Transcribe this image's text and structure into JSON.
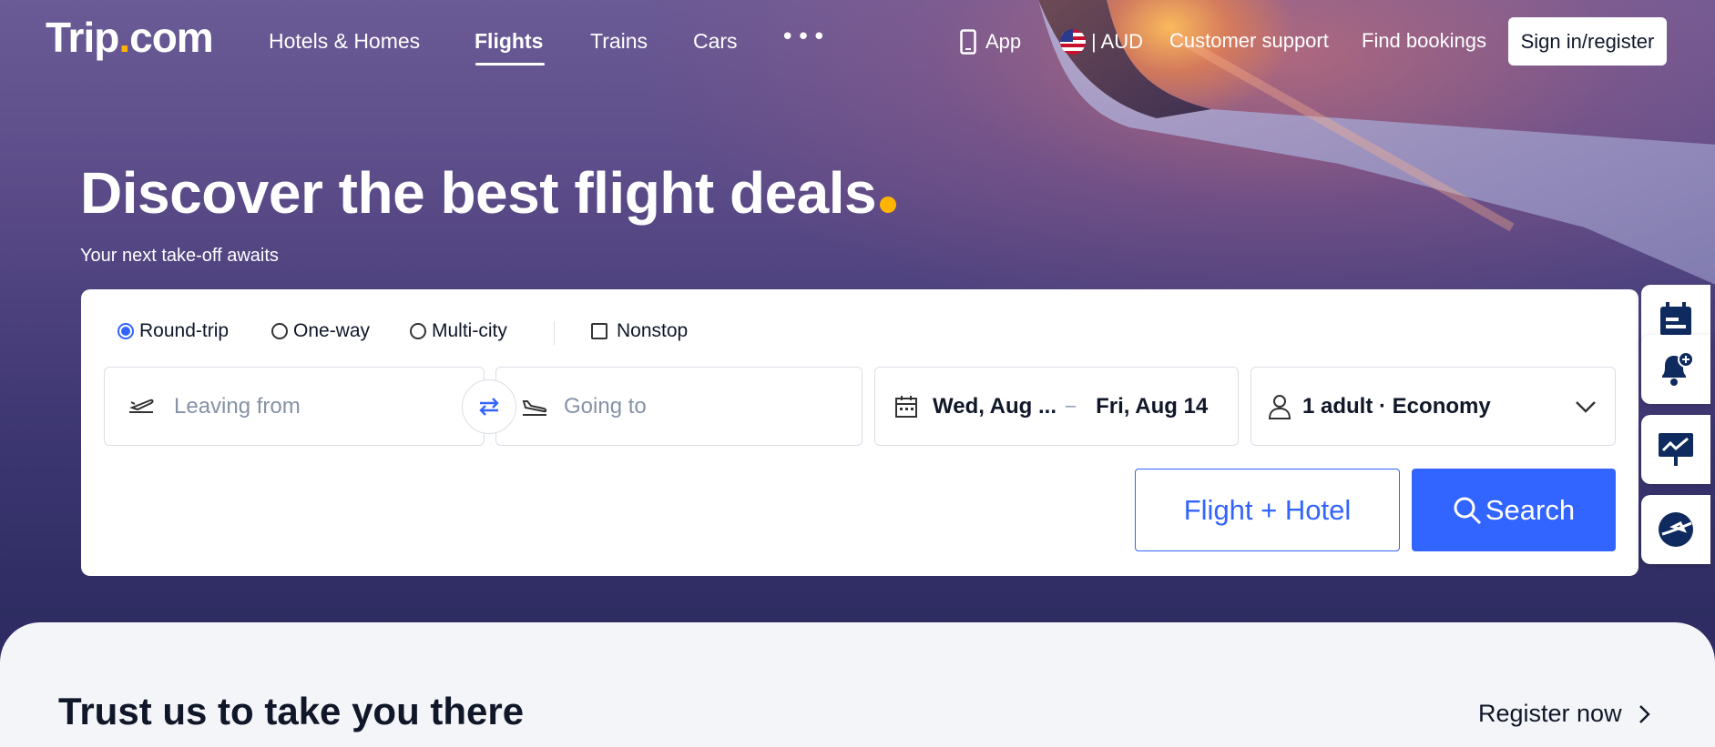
{
  "brand": {
    "logo_main": "Trip",
    "logo_dot": ".",
    "logo_suffix": "com"
  },
  "nav": {
    "items": [
      {
        "label": "Hotels & Homes"
      },
      {
        "label": "Flights",
        "active": true
      },
      {
        "label": "Trains"
      },
      {
        "label": "Cars"
      }
    ],
    "more_label": "•••",
    "app_label": "App",
    "currency_label": "| AUD",
    "support_label": "Customer support",
    "find_bookings_label": "Find bookings",
    "signin_label": "Sign in/register"
  },
  "hero": {
    "title": "Discover the best flight deals",
    "subtitle": "Your next take-off awaits"
  },
  "search": {
    "trip_types": [
      {
        "label": "Round-trip",
        "selected": true
      },
      {
        "label": "One-way",
        "selected": false
      },
      {
        "label": "Multi-city",
        "selected": false
      }
    ],
    "nonstop_label": "Nonstop",
    "leaving_placeholder": "Leaving from",
    "going_placeholder": "Going to",
    "depart_date": "Wed, Aug ...",
    "date_separator": "–",
    "return_date": "Fri, Aug 14",
    "passengers": "1 adult · Economy",
    "flight_hotel_label": "Flight + Hotel",
    "search_label": "Search"
  },
  "bottom": {
    "heading": "Trust us to take you there",
    "register_label": "Register now"
  },
  "colors": {
    "accent": "#3264ff",
    "brand_dot": "#ffb400",
    "text": "#0f1729"
  },
  "icons": [
    "phone-icon",
    "us-flag-icon",
    "takeoff-icon",
    "landing-icon",
    "swap-icon",
    "calendar-icon",
    "person-icon",
    "chevron-down-icon",
    "search-icon",
    "schedule-icon",
    "price-alert-icon",
    "price-trend-icon",
    "flight-status-icon",
    "chevron-right-icon"
  ]
}
